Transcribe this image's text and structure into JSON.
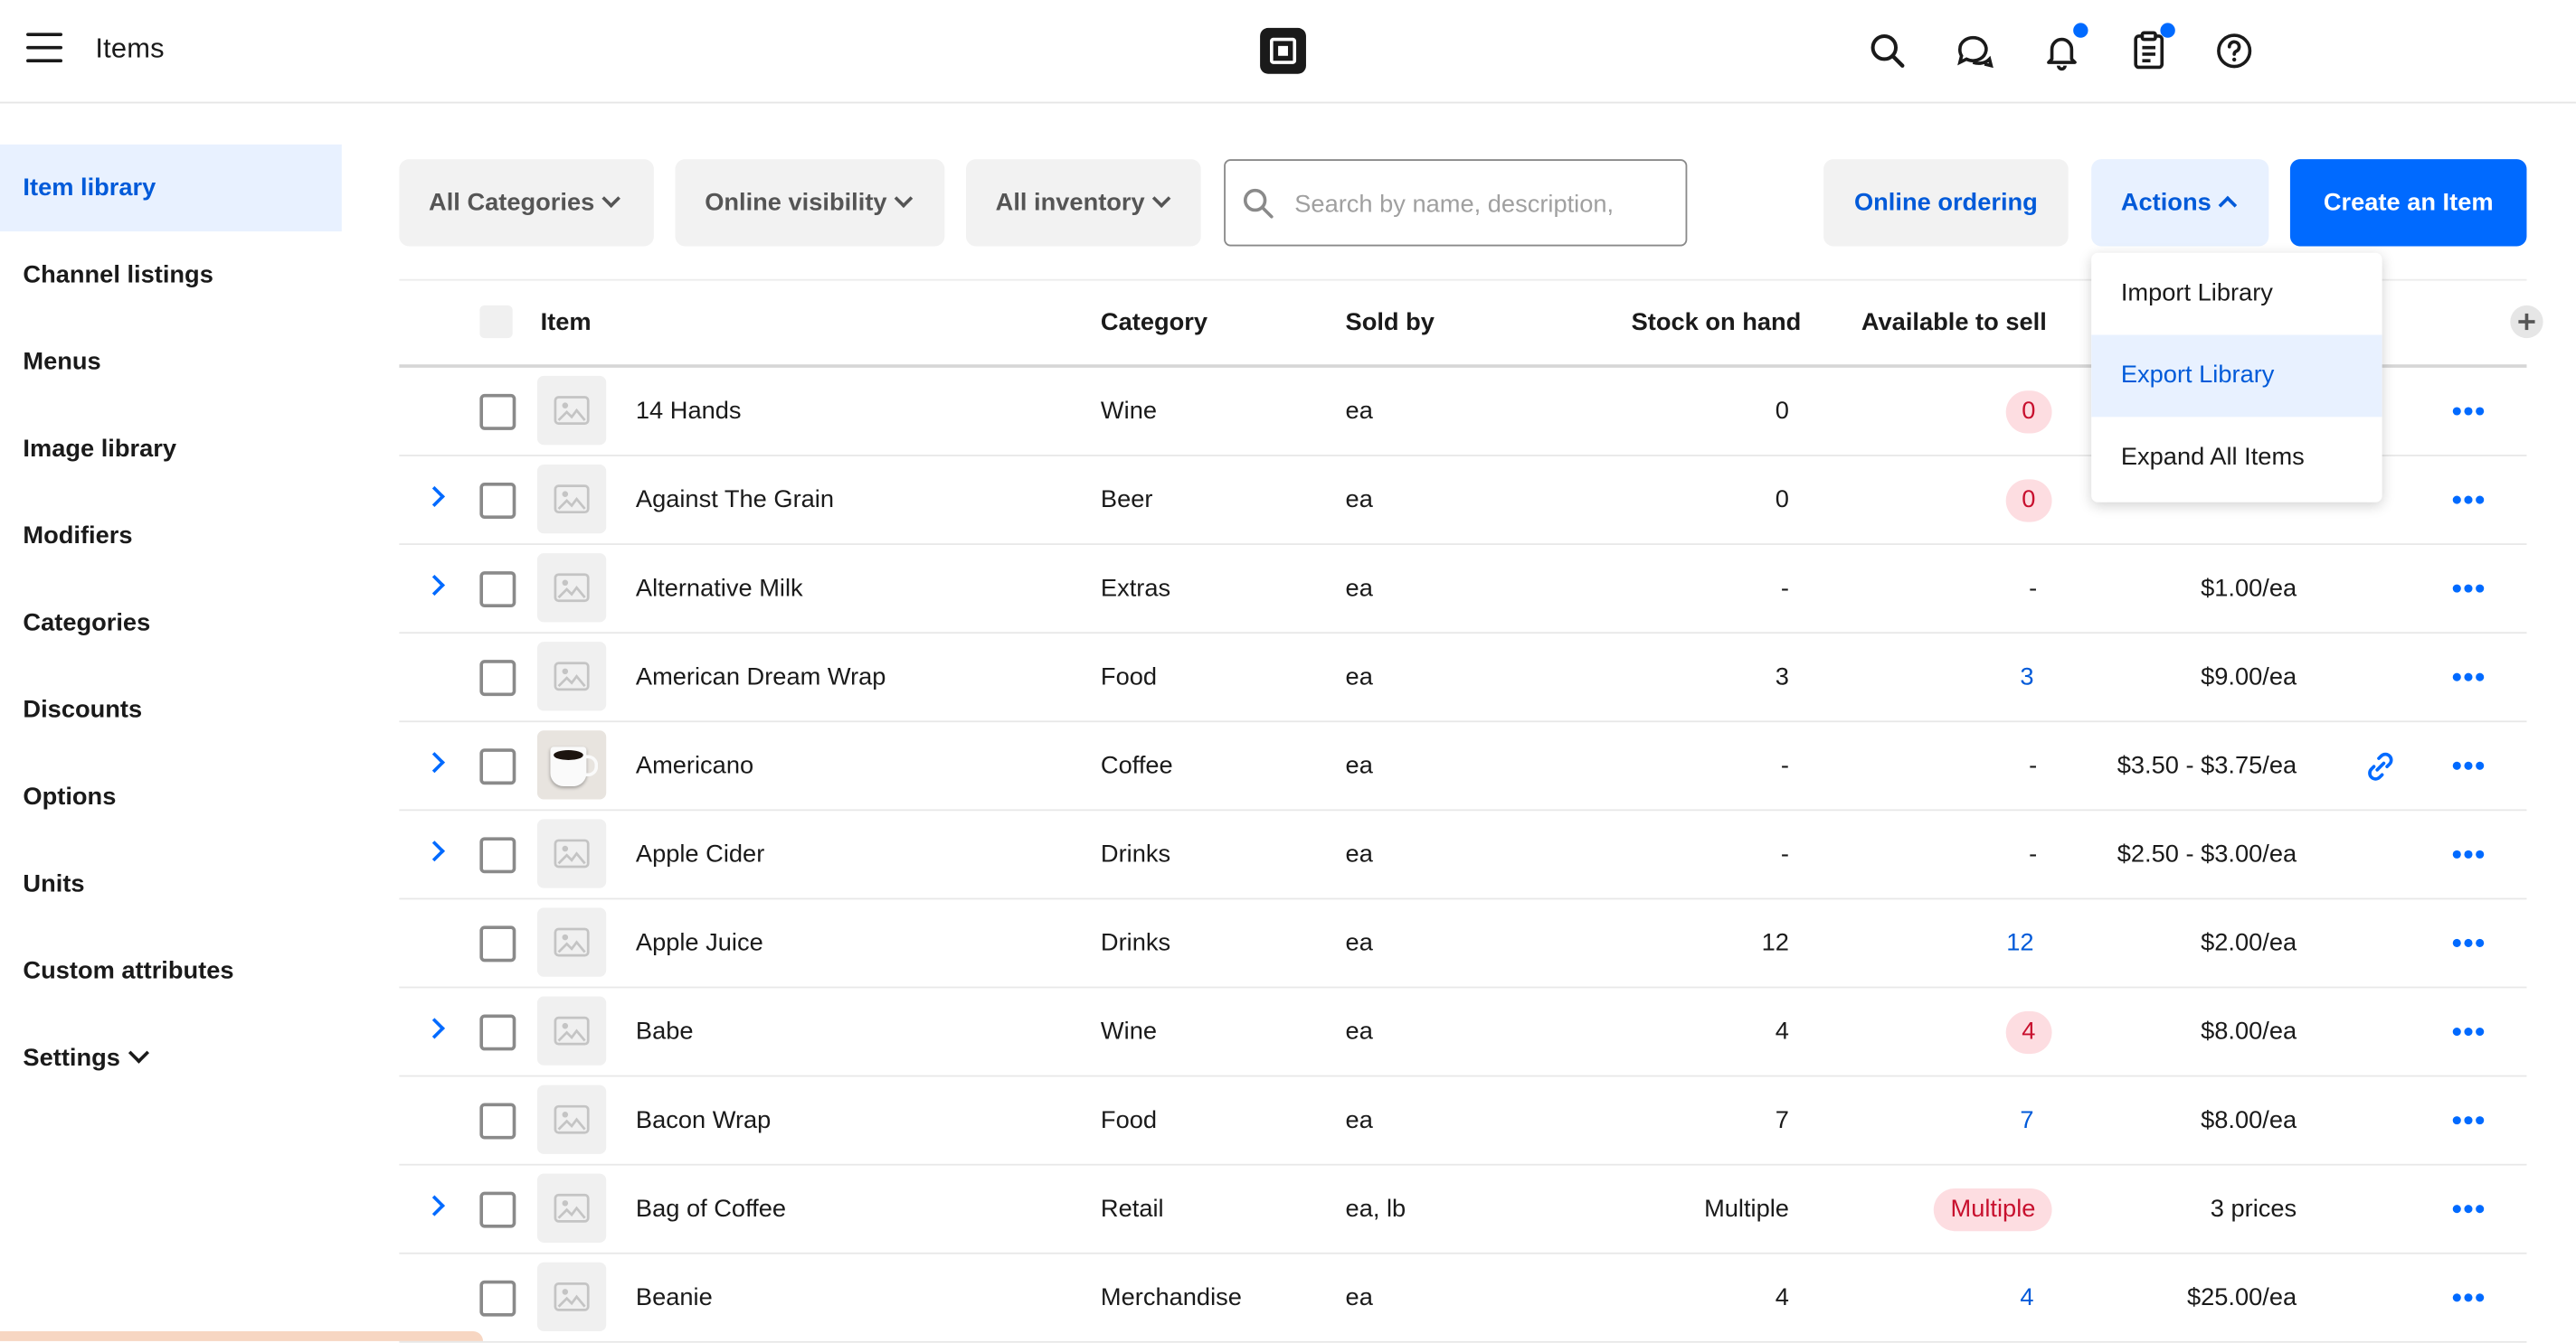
{
  "header": {
    "title": "Items",
    "icons": [
      "menu-icon",
      "square-logo",
      "search-icon",
      "messages-icon",
      "bell-icon",
      "clipboard-icon",
      "help-icon"
    ],
    "accent": "#006aff"
  },
  "sidebar": {
    "items": [
      {
        "label": "Item library",
        "active": true
      },
      {
        "label": "Channel listings"
      },
      {
        "label": "Menus"
      },
      {
        "label": "Image library"
      },
      {
        "label": "Modifiers"
      },
      {
        "label": "Categories"
      },
      {
        "label": "Discounts"
      },
      {
        "label": "Options"
      },
      {
        "label": "Units"
      },
      {
        "label": "Custom attributes"
      },
      {
        "label": "Settings"
      }
    ]
  },
  "toolbar": {
    "filter_categories": "All Categories",
    "filter_visibility": "Online visibility",
    "filter_inventory": "All inventory",
    "search_placeholder": "Search by name, description,",
    "online_ordering": "Online ordering",
    "actions": "Actions",
    "create": "Create an Item"
  },
  "actions_menu": {
    "items": [
      "Import Library",
      "Export Library",
      "Expand All Items"
    ],
    "highlighted": "Export Library"
  },
  "table": {
    "columns": {
      "item": "Item",
      "category": "Category",
      "sold_by": "Sold by",
      "stock": "Stock on hand",
      "available": "Available to sell"
    },
    "rows": [
      {
        "name": "14 Hands",
        "category": "Wine",
        "sold_by": "ea",
        "stock": "0",
        "available": "0",
        "price": "",
        "expandable": false,
        "alert": true
      },
      {
        "name": "Against The Grain",
        "category": "Beer",
        "sold_by": "ea",
        "stock": "0",
        "available": "0",
        "price": "",
        "expandable": true,
        "alert": true
      },
      {
        "name": "Alternative Milk",
        "category": "Extras",
        "sold_by": "ea",
        "stock": "-",
        "available": "-",
        "price": "$1.00/ea",
        "expandable": true
      },
      {
        "name": "American Dream Wrap",
        "category": "Food",
        "sold_by": "ea",
        "stock": "3",
        "available": "3",
        "price": "$9.00/ea",
        "expandable": false,
        "link": true
      },
      {
        "name": "Americano",
        "category": "Coffee",
        "sold_by": "ea",
        "stock": "-",
        "available": "-",
        "price": "$3.50 - $3.75/ea",
        "expandable": true,
        "photo": true,
        "online_link": true
      },
      {
        "name": "Apple Cider",
        "category": "Drinks",
        "sold_by": "ea",
        "stock": "-",
        "available": "-",
        "price": "$2.50 - $3.00/ea",
        "expandable": true
      },
      {
        "name": "Apple Juice",
        "category": "Drinks",
        "sold_by": "ea",
        "stock": "12",
        "available": "12",
        "price": "$2.00/ea",
        "expandable": false,
        "link": true
      },
      {
        "name": "Babe",
        "category": "Wine",
        "sold_by": "ea",
        "stock": "4",
        "available": "4",
        "price": "$8.00/ea",
        "expandable": true,
        "alert": true
      },
      {
        "name": "Bacon Wrap",
        "category": "Food",
        "sold_by": "ea",
        "stock": "7",
        "available": "7",
        "price": "$8.00/ea",
        "expandable": false,
        "link": true
      },
      {
        "name": "Bag of Coffee",
        "category": "Retail",
        "sold_by": "ea, lb",
        "stock": "Multiple",
        "available": "Multiple",
        "price": "3 prices",
        "expandable": true,
        "alert": true
      },
      {
        "name": "Beanie",
        "category": "Merchandise",
        "sold_by": "ea",
        "stock": "4",
        "available": "4",
        "price": "$25.00/ea",
        "expandable": false,
        "link": true
      }
    ]
  }
}
